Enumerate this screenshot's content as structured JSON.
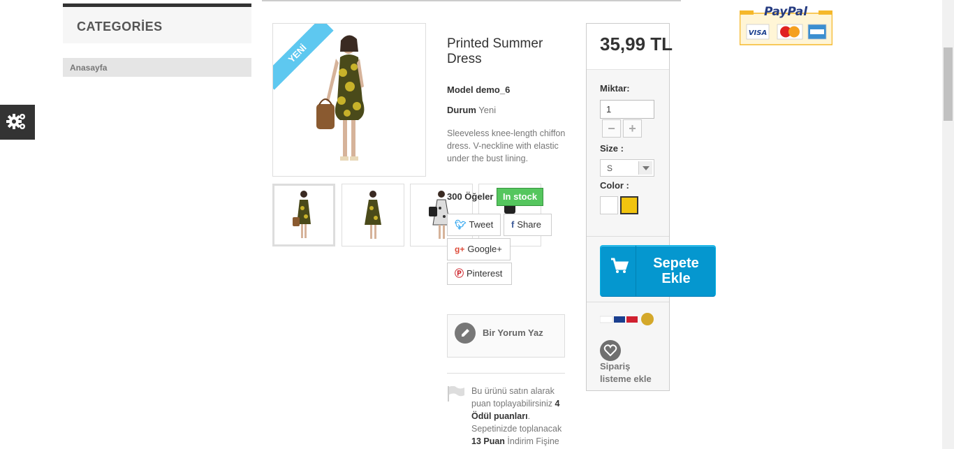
{
  "sidebar": {
    "categories_title": "CATEGORİES",
    "items": [
      {
        "label": "Anasayfa"
      }
    ]
  },
  "product": {
    "badge": "YENİ",
    "title": "Printed Summer Dress",
    "model_label": "Model",
    "model_value": "demo_6",
    "condition_label": "Durum",
    "condition_value": "Yeni",
    "description": "Sleeveless knee-length chiffon dress. V-neckline with elastic under the bust lining.",
    "quantity_text": "300 Öğeler",
    "stock_status": "In stock"
  },
  "social": {
    "tweet": "Tweet",
    "share": "Share",
    "google": "Google+",
    "pinterest": "Pinterest"
  },
  "review": {
    "label": "Bir Yorum Yaz"
  },
  "loyalty": {
    "text1": "Bu ürünü satın alarak puan toplayabilirsiniz",
    "points": "4 Ödül puanları",
    "text2": ". Sepetinizde toplanacak",
    "voucher_points": "13 Puan",
    "text3": "İndirim Fişine"
  },
  "buy_box": {
    "price": "35,99 TL",
    "quantity_label": "Miktar:",
    "quantity_value": "1",
    "size_label": "Size :",
    "size_value": "S",
    "color_label": "Color :",
    "colors": [
      "#ffffff",
      "#f1c40f"
    ],
    "add_to_cart": "Sepete Ekle",
    "wishlist": "Sipariş listeme ekle"
  },
  "colors": {
    "cart_button": "#0597cf",
    "in_stock": "#55c65e",
    "ribbon": "#5ec8f0"
  },
  "paypal": {
    "brand": "PayPal",
    "cards": [
      "VISA",
      "MasterCard",
      "AMEX"
    ]
  }
}
